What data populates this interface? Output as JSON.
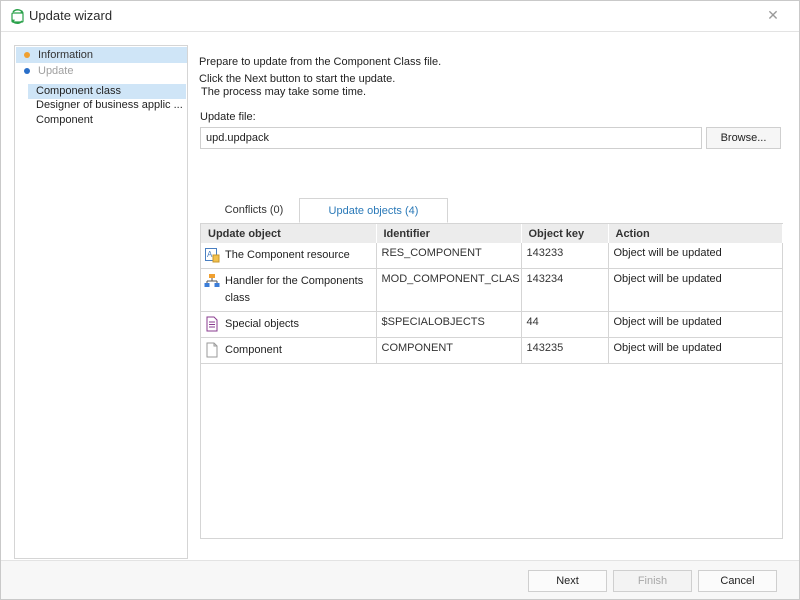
{
  "window": {
    "title": "Update wizard",
    "close_icon": "close-icon",
    "title_icon": "update-refresh-icon"
  },
  "sidebar": {
    "steps": [
      {
        "label": "Information",
        "status_color": "#f0a030",
        "active": true
      },
      {
        "label": "Update",
        "status_color": "#2a6fc9",
        "active": false
      }
    ],
    "subitems": [
      {
        "label": "Component class",
        "selected": true
      },
      {
        "label": "Designer of business applic ...",
        "selected": false
      },
      {
        "label": "Component",
        "selected": false
      }
    ]
  },
  "main": {
    "description": [
      "Prepare to update from the Component Class file.",
      "Click the Next button to start the update.",
      "The process may take some time."
    ],
    "file_label": "Update file:",
    "file_value": "upd.updpack",
    "browse_label": "Browse...",
    "tabs": [
      {
        "label": "Conflicts  (0)",
        "active": false
      },
      {
        "label": "Update objects (4)",
        "active": true
      }
    ],
    "table": {
      "columns": [
        "Update object",
        "Identifier",
        "Object key",
        "Action"
      ],
      "rows": [
        {
          "icon": "resource-icon",
          "object": "The Component resource",
          "identifier": "RES_COMPONENT",
          "key": "143233",
          "action": "Object will be updated"
        },
        {
          "icon": "handler-hierarchy-icon",
          "object": "Handler for the Components class",
          "identifier": "MOD_COMPONENT_CLAS",
          "key": "143234",
          "action": "Object will be updated"
        },
        {
          "icon": "special-objects-icon",
          "object": "Special objects",
          "identifier": "$SPECIALOBJECTS",
          "key": "44",
          "action": "Object will be updated"
        },
        {
          "icon": "document-icon",
          "object": "Component",
          "identifier": "COMPONENT",
          "key": "143235",
          "action": "Object will be updated"
        }
      ]
    }
  },
  "footer": {
    "next_label": "Next",
    "finish_label": "Finish",
    "cancel_label": "Cancel"
  },
  "colors": {
    "selection": "#cfe5f7",
    "accent": "#2a79b8"
  }
}
